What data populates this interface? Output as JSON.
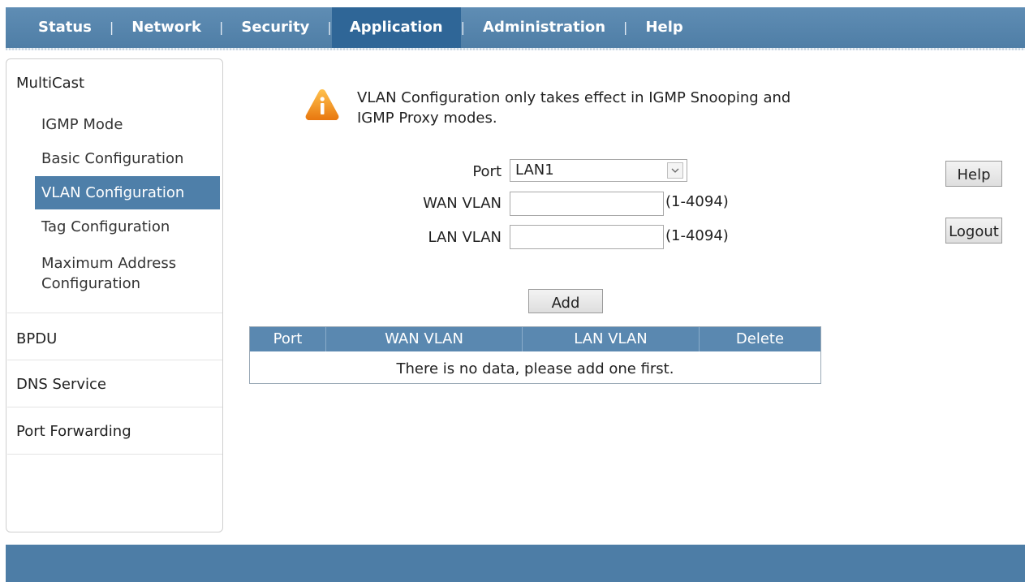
{
  "nav": {
    "items": [
      "Status",
      "Network",
      "Security",
      "Application",
      "Administration",
      "Help"
    ],
    "active": "Application"
  },
  "sidebar": {
    "groups": {
      "multicast": "MultiCast",
      "bpdu": "BPDU",
      "dns": "DNS Service",
      "port_forwarding": "Port Forwarding"
    },
    "items": {
      "igmp_mode": "IGMP Mode",
      "basic": "Basic Configuration",
      "vlan": "VLAN Configuration",
      "tag": "Tag Configuration",
      "max_addr_1": "Maximum Address",
      "max_addr_2": "Configuration"
    },
    "active": "VLAN Configuration"
  },
  "notice": {
    "line1": "VLAN Configuration only takes effect in IGMP Snooping and",
    "line2": "IGMP Proxy modes.",
    "icon": "warning-icon"
  },
  "form": {
    "port_label": "Port",
    "port_value": "LAN1",
    "wan_label": "WAN VLAN",
    "wan_value": "",
    "wan_range": "(1-4094)",
    "lan_label": "LAN VLAN",
    "lan_value": "",
    "lan_range": "(1-4094)",
    "add_label": "Add"
  },
  "side_buttons": {
    "help": "Help",
    "logout": "Logout"
  },
  "table": {
    "columns": [
      "Port",
      "WAN VLAN",
      "LAN VLAN",
      "Delete"
    ],
    "empty_message": "There is no data, please add one first."
  },
  "colors": {
    "nav": "#5586af",
    "nav_active": "#2f6697",
    "sidebar_active": "#4e7fa9",
    "table_header": "#5a88b0",
    "footer": "#4d7da6",
    "warning": "#f08a1a"
  }
}
